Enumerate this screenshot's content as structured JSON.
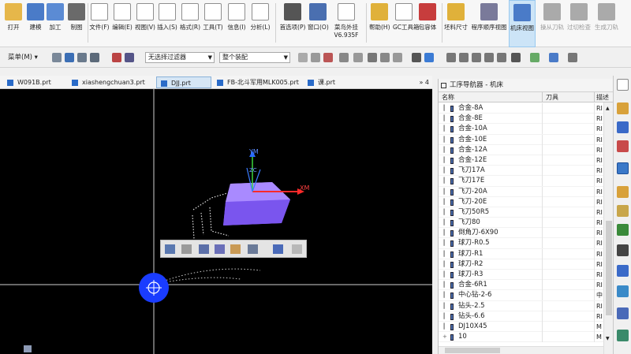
{
  "ribbon": {
    "items": [
      {
        "label": "打开",
        "icon": "folder-open-icon"
      },
      {
        "label": "建模",
        "icon": "modeling-icon"
      },
      {
        "label": "加工",
        "icon": "manufacturing-icon"
      },
      {
        "label": "制图",
        "icon": "drafting-icon"
      },
      {
        "label": "文件(F)",
        "icon": "file-menu-icon"
      },
      {
        "label": "编辑(E)",
        "icon": "edit-menu-icon"
      },
      {
        "label": "视图(V)",
        "icon": "view-menu-icon"
      },
      {
        "label": "插入(S)",
        "icon": "insert-menu-icon"
      },
      {
        "label": "格式(R)",
        "icon": "format-menu-icon"
      },
      {
        "label": "工具(T)",
        "icon": "tools-menu-icon"
      },
      {
        "label": "信息(I)",
        "icon": "info-menu-icon"
      },
      {
        "label": "分析(L)",
        "icon": "analysis-menu-icon"
      },
      {
        "label": "首选项(P)",
        "icon": "preferences-icon"
      },
      {
        "label": "窗口(O)",
        "icon": "window-icon"
      },
      {
        "label": "菜鸟外挂",
        "sublabel": "V6.935F",
        "icon": "plugin-icon"
      },
      {
        "label": "帮助(H)",
        "icon": "help-icon"
      },
      {
        "label": "GC工具箱",
        "icon": "gc-toolbox-icon"
      },
      {
        "label": "包容体",
        "icon": "bounding-body-icon"
      },
      {
        "label": "坯料尺寸",
        "icon": "blank-size-icon"
      },
      {
        "label": "程序顺序视图",
        "icon": "program-order-view-icon"
      },
      {
        "label": "机床视图",
        "icon": "machine-tool-view-icon"
      },
      {
        "label": "操从刀轨",
        "icon": "toolpath-icon"
      },
      {
        "label": "过切检查",
        "icon": "gouge-check-icon"
      },
      {
        "label": "生成刀轨",
        "icon": "generate-toolpath-icon"
      }
    ]
  },
  "toolbar2": {
    "menu_label": "菜单(M)",
    "filter_value": "无选择过滤器",
    "assembly_value": "整个装配"
  },
  "tabs": [
    {
      "label": "W091B.prt",
      "active": false
    },
    {
      "label": "xiashengchuan3.prt",
      "active": false
    },
    {
      "label": "DJJ.prt",
      "active": true
    },
    {
      "label": "FB-北斗军用MLK005.prt",
      "active": false
    },
    {
      "label": "课.prt",
      "active": false
    }
  ],
  "tabs_more": "» 4",
  "viewport": {
    "axis_ym": "YM",
    "axis_xm": "XM",
    "axis_zc": "ZC"
  },
  "navigator": {
    "title": "工序导航器 - 机床",
    "columns": {
      "name": "名称",
      "tool": "刀具",
      "desc": "描述"
    },
    "rows": [
      {
        "name": "合金-8A",
        "desc": "RI"
      },
      {
        "name": "合金-8E",
        "desc": "RI"
      },
      {
        "name": "合金-10A",
        "desc": "RI"
      },
      {
        "name": "合金-10E",
        "desc": "RI"
      },
      {
        "name": "合金-12A",
        "desc": "RI"
      },
      {
        "name": "合金-12E",
        "desc": "RI"
      },
      {
        "name": "飞刀17A",
        "desc": "RI"
      },
      {
        "name": "飞刀17E",
        "desc": "RI"
      },
      {
        "name": "飞刀-20A",
        "desc": "RI"
      },
      {
        "name": "飞刀-20E",
        "desc": "RI"
      },
      {
        "name": "飞刀50R5",
        "desc": "RI"
      },
      {
        "name": "飞刀80",
        "desc": "RI"
      },
      {
        "name": "倒角刀-6X90",
        "desc": "RI"
      },
      {
        "name": "球刀-R0.5",
        "desc": "RI"
      },
      {
        "name": "球刀-R1",
        "desc": "RI"
      },
      {
        "name": "球刀-R2",
        "desc": "RI"
      },
      {
        "name": "球刀-R3",
        "desc": "RI"
      },
      {
        "name": "合金-6R1",
        "desc": "RI"
      },
      {
        "name": "中心钻-2-6",
        "desc": "中"
      },
      {
        "name": "钻头-2.5",
        "desc": "RI"
      },
      {
        "name": "钻头-6.6",
        "desc": "RI"
      },
      {
        "name": "DJ10X45",
        "desc": "M"
      },
      {
        "name": "10",
        "desc": "M"
      }
    ]
  },
  "colors": {
    "viewport_bg": "#000000",
    "block": "#8a62ff",
    "selected": "#cce4f7",
    "accent": "#1f5fbf"
  }
}
